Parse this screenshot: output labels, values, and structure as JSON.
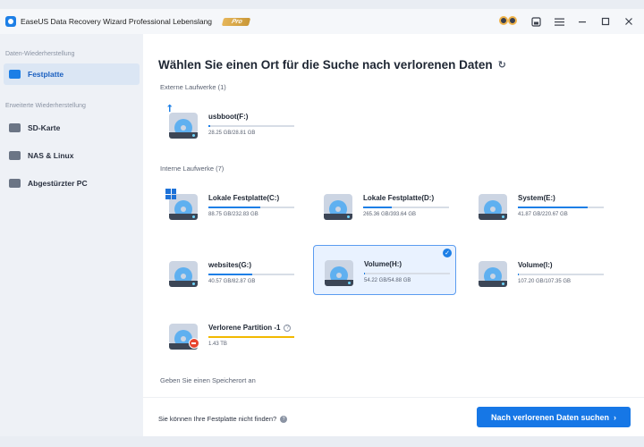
{
  "window": {
    "title": "EaseUS Data Recovery Wizard Professional Lebenslang",
    "badge": "Pro",
    "icons": [
      "owl-icon",
      "save-icon",
      "menu-icon",
      "minimize-icon",
      "maximize-icon",
      "close-icon"
    ]
  },
  "sidebar": {
    "section1": "Daten-Wiederherstellung",
    "section2": "Erweiterte Wiederherstellung",
    "items": [
      {
        "label": "Festplatte",
        "icon": "hard-drive-icon",
        "active": true
      },
      {
        "label": "SD-Karte",
        "icon": "sd-card-icon",
        "active": false
      },
      {
        "label": "NAS & Linux",
        "icon": "nas-icon",
        "active": false
      },
      {
        "label": "Abgestürzter PC",
        "icon": "crashed-pc-icon",
        "active": false
      }
    ]
  },
  "main": {
    "title": "Wählen Sie einen Ort für die Suche nach verlorenen Daten",
    "external_label": "Externe Laufwerke (1)",
    "internal_label": "Interne Laufwerke (7)",
    "location_label": "Geben Sie einen Speicherort an",
    "external_drives": [
      {
        "name": "usbboot(F:)",
        "size": "28.25 GB/28.81 GB",
        "fill": 0.02
      }
    ],
    "internal_drives": [
      {
        "name": "Lokale Festplatte(C:)",
        "size": "88.75 GB/232.83 GB",
        "fill": 0.6
      },
      {
        "name": "Lokale Festplatte(D:)",
        "size": "265.36 GB/393.64 GB",
        "fill": 0.33
      },
      {
        "name": "System(E:)",
        "size": "41.87 GB/220.67 GB",
        "fill": 0.81
      },
      {
        "name": "websites(G:)",
        "size": "40.57 GB/82.87 GB",
        "fill": 0.51
      },
      {
        "name": "Volume(H:)",
        "size": "54.22 GB/54.88 GB",
        "fill": 0.01,
        "selected": true
      },
      {
        "name": "Volume(I:)",
        "size": "107.20 GB/107.35 GB",
        "fill": 0.01
      },
      {
        "name": "Verlorene Partition -1",
        "size": "1.43 TB",
        "fill": 1.0
      }
    ]
  },
  "footer": {
    "link": "Sie können Ihre Festplatte nicht finden?",
    "scan_button": "Nach verlorenen Daten suchen"
  }
}
